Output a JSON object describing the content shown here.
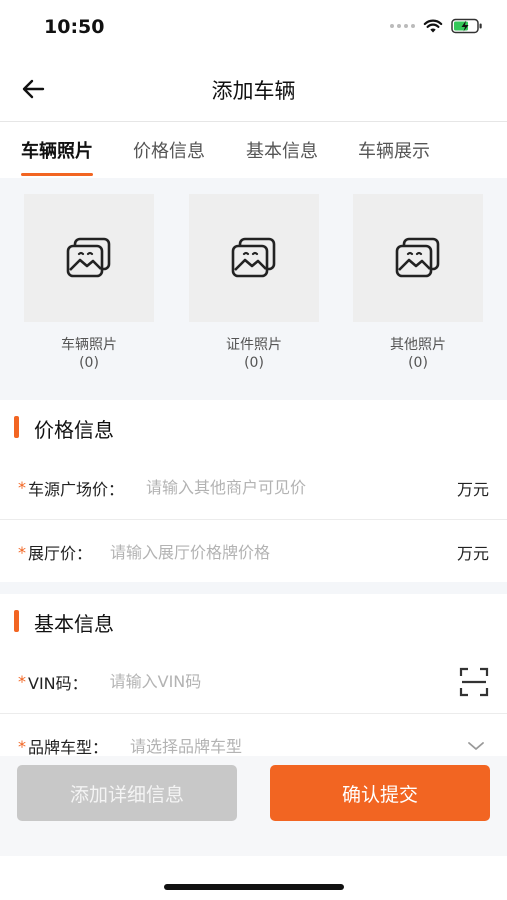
{
  "status_bar": {
    "time": "10:50"
  },
  "nav": {
    "title": "添加车辆"
  },
  "tabs": [
    {
      "label": "车辆照片",
      "active": true
    },
    {
      "label": "价格信息",
      "active": false
    },
    {
      "label": "基本信息",
      "active": false
    },
    {
      "label": "车辆展示",
      "active": false
    }
  ],
  "photos": [
    {
      "label": "车辆照片",
      "count": "(0)",
      "icon": "image-icon"
    },
    {
      "label": "证件照片",
      "count": "(0)",
      "icon": "image-icon"
    },
    {
      "label": "其他照片",
      "count": "(0)",
      "icon": "image-icon"
    }
  ],
  "price_section": {
    "title": "价格信息",
    "fields": [
      {
        "required": "*",
        "label": "车源广场价：",
        "placeholder": "请输入其他商户可见价",
        "value": "",
        "unit": "万元"
      },
      {
        "required": "*",
        "label": "展厅价：",
        "placeholder": "请输入展厅价格牌价格",
        "value": "",
        "unit": "万元"
      }
    ]
  },
  "basic_section": {
    "title": "基本信息",
    "fields": [
      {
        "required": "*",
        "label": "VIN码：",
        "placeholder": "请输入VIN码",
        "value": "",
        "icon": "scan-icon"
      },
      {
        "required": "*",
        "label": "品牌车型：",
        "placeholder": "请选择品牌车型",
        "value": "",
        "icon": "chevron-down-icon"
      }
    ]
  },
  "buttons": {
    "secondary": "添加详细信息",
    "primary": "确认提交"
  },
  "colors": {
    "accent": "#f26522",
    "disabled_button": "#c8c8c8",
    "section_bg": "#f4f6f9"
  }
}
